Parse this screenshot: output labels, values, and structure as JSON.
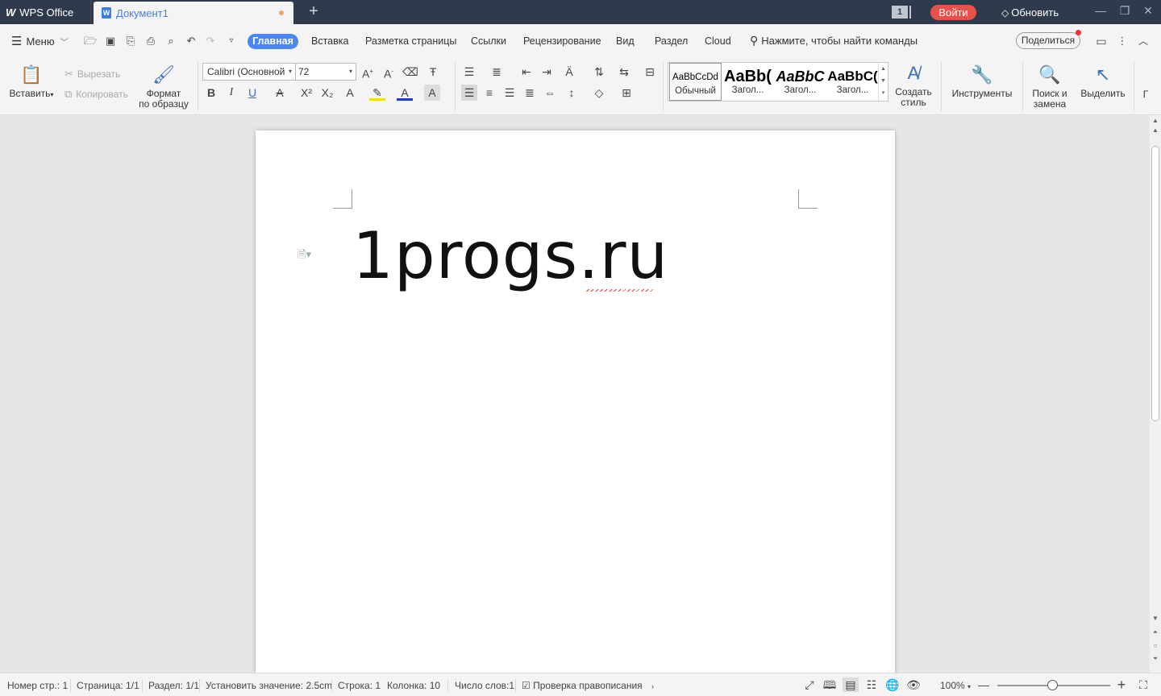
{
  "titlebar": {
    "app_name": "WPS Office",
    "doc_tab": "Документ1",
    "doc_icon_letter": "W",
    "counter": "1",
    "login": "Войти",
    "update": "Обновить"
  },
  "menu": {
    "label": "Меню",
    "tabs": [
      "Главная",
      "Вставка",
      "Разметка страницы",
      "Ссылки",
      "Рецензирование",
      "Вид",
      "Раздел",
      "Cloud"
    ],
    "command_search": "Нажмите, чтобы найти команды",
    "share": "Поделиться"
  },
  "ribbon": {
    "paste": "Вставить",
    "cut": "Вырезать",
    "copy": "Копировать",
    "format_painter_1": "Формат",
    "format_painter_2": "по образцу",
    "font_name": "Calibri (Основной",
    "font_size": "72",
    "styles": [
      {
        "preview": "AaBbCcDd",
        "name": "Обычный"
      },
      {
        "preview": "AaBb(",
        "name": "Загол..."
      },
      {
        "preview": "AaBbC",
        "name": "Загол..."
      },
      {
        "preview": "AaBbC(",
        "name": "Загол..."
      }
    ],
    "create_style_1": "Создать",
    "create_style_2": "стиль",
    "tools": "Инструменты",
    "find_replace_1": "Поиск и",
    "find_replace_2": "замена",
    "select": "Выделить",
    "truncated": "Г"
  },
  "document": {
    "text": "1progs.ru"
  },
  "status": {
    "page_num": "Номер стр.: 1",
    "page": "Страница: 1/1",
    "section": "Раздел: 1/1",
    "set_value": "Установить значение: 2.5cm",
    "line": "Строка: 1",
    "column": "Колонка: 10",
    "words": "Число слов:1",
    "spellcheck": "Проверка правописания",
    "zoom": "100%",
    "zoom_level": 0.45
  },
  "colors": {
    "titlebar": "#2f3a4c",
    "accent": "#4a87f5",
    "login": "#e8504a"
  }
}
